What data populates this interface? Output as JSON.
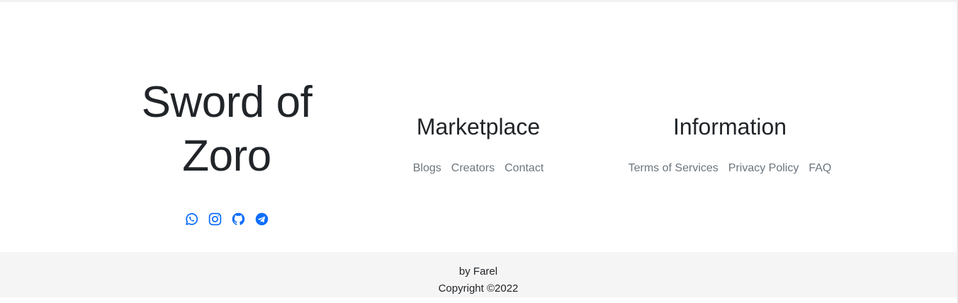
{
  "brand": {
    "title_line1": "Sword of",
    "title_line2": "Zoro"
  },
  "social": {
    "accent_color": "#0d6efd",
    "icons": [
      "whatsapp-icon",
      "instagram-icon",
      "github-icon",
      "telegram-icon"
    ]
  },
  "marketplace": {
    "heading": "Marketplace",
    "links": [
      "Blogs",
      "Creators",
      "Contact"
    ]
  },
  "information": {
    "heading": "Information",
    "links": [
      "Terms of Services",
      "Privacy Policy",
      "FAQ"
    ]
  },
  "bottom": {
    "author": "by Farel",
    "copyright": "Copyright ©2022"
  }
}
